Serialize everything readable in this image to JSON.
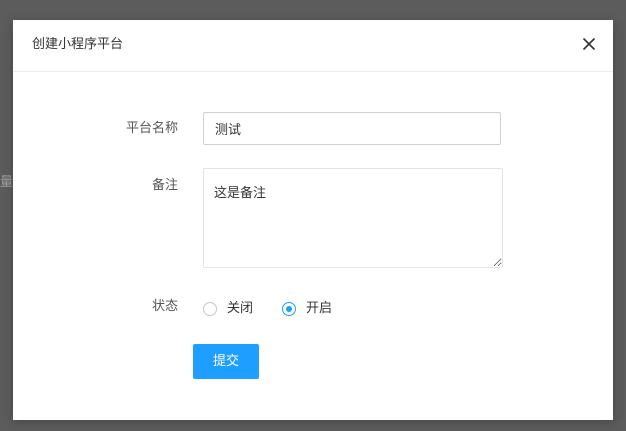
{
  "backdrop": {
    "partial_glyph": "量"
  },
  "modal": {
    "title": "创建小程序平台",
    "close_icon": "close-icon"
  },
  "form": {
    "name": {
      "label": "平台名称",
      "value": "测试"
    },
    "remark": {
      "label": "备注",
      "value": "这是备注"
    },
    "status": {
      "label": "状态",
      "options": [
        {
          "label": "关闭",
          "checked": false
        },
        {
          "label": "开启",
          "checked": true
        }
      ]
    },
    "submit_label": "提交"
  },
  "colors": {
    "accent": "#1e9fff",
    "overlay": "#5c5c5c"
  }
}
